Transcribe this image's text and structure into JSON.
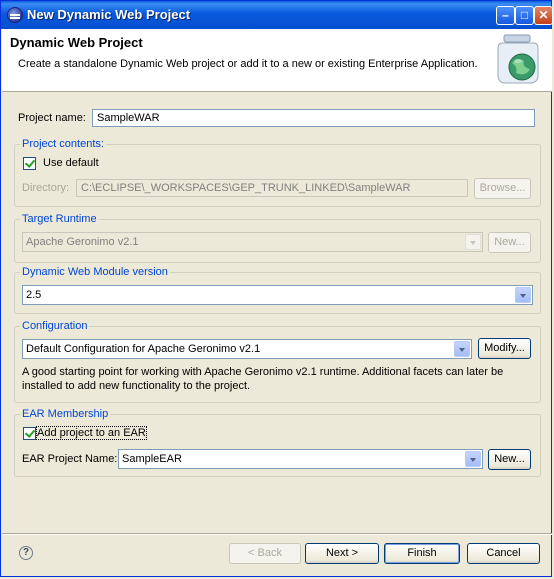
{
  "window": {
    "title": "New Dynamic Web Project"
  },
  "header": {
    "title": "Dynamic Web Project",
    "description": "Create a standalone Dynamic Web project or add it to a new or existing Enterprise Application."
  },
  "project_name": {
    "label": "Project name:",
    "value": "SampleWAR"
  },
  "project_contents": {
    "title": "Project contents:",
    "use_default": "Use default",
    "directory_label": "Directory:",
    "directory_value": "C:\\ECLIPSE\\_WORKSPACES\\GEP_TRUNK_LINKED\\SampleWAR",
    "browse": "Browse..."
  },
  "target_runtime": {
    "title": "Target Runtime",
    "value": "Apache Geronimo v2.1",
    "new": "New..."
  },
  "module_version": {
    "title": "Dynamic Web Module version",
    "value": "2.5"
  },
  "configuration": {
    "title": "Configuration",
    "value": "Default Configuration for Apache Geronimo v2.1",
    "modify": "Modify...",
    "description": "A good starting point for working with Apache Geronimo v2.1 runtime. Additional facets can later be installed to add new functionality to the project."
  },
  "ear": {
    "title": "EAR Membership",
    "add_label": "Add project to an EAR",
    "name_label": "EAR Project Name:",
    "name_value": "SampleEAR",
    "new": "New..."
  },
  "footer": {
    "back": "< Back",
    "next": "Next >",
    "finish": "Finish",
    "cancel": "Cancel"
  },
  "icons": {
    "window": "eclipse-icon",
    "banner": "web-jar-globe-icon",
    "help": "help-icon"
  }
}
